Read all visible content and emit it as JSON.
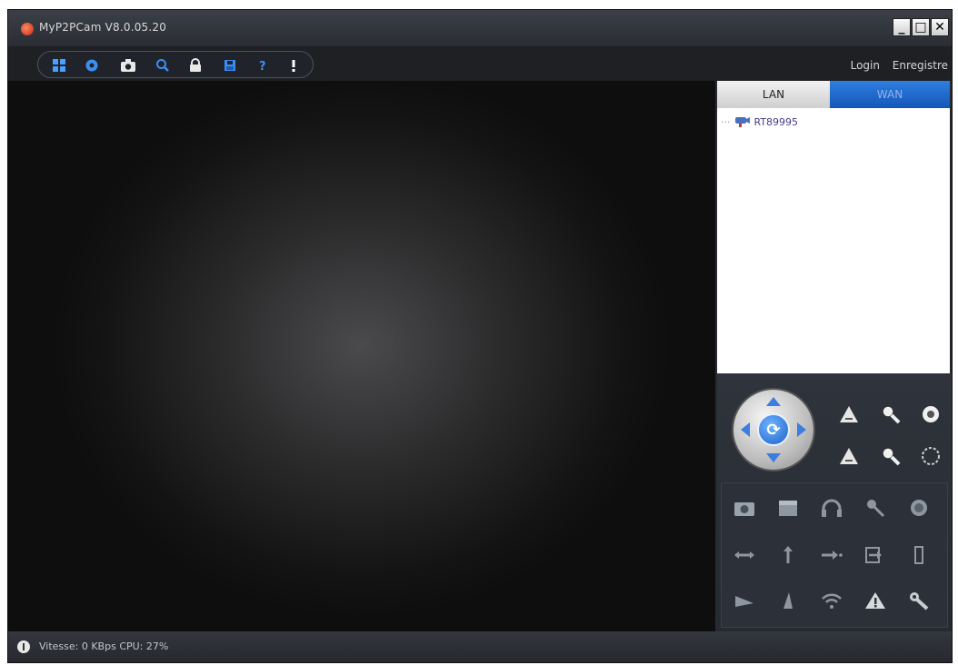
{
  "window": {
    "title": "MyP2PCam  V8.0.05.20",
    "controls": {
      "minimize": "_",
      "maximize": "□",
      "close": "✕"
    }
  },
  "toolbar": {
    "icons": [
      "grid-view-icon",
      "settings-icon",
      "snapshot-icon",
      "search-icon",
      "lock-icon",
      "save-icon",
      "help-icon",
      "info-icon"
    ]
  },
  "auth": {
    "login": "Login",
    "register": "Enregistre"
  },
  "tabs": [
    {
      "label": "LAN",
      "active": true
    },
    {
      "label": "WAN",
      "active": false
    }
  ],
  "devices": [
    {
      "name": "RT89995"
    }
  ],
  "status": {
    "text": "Vitesse: 0 KBps CPU:  27%"
  },
  "colors": {
    "accent": "#3c7ee0",
    "window_bg": "#2b2f36",
    "tab_wan": "#1456b8"
  }
}
